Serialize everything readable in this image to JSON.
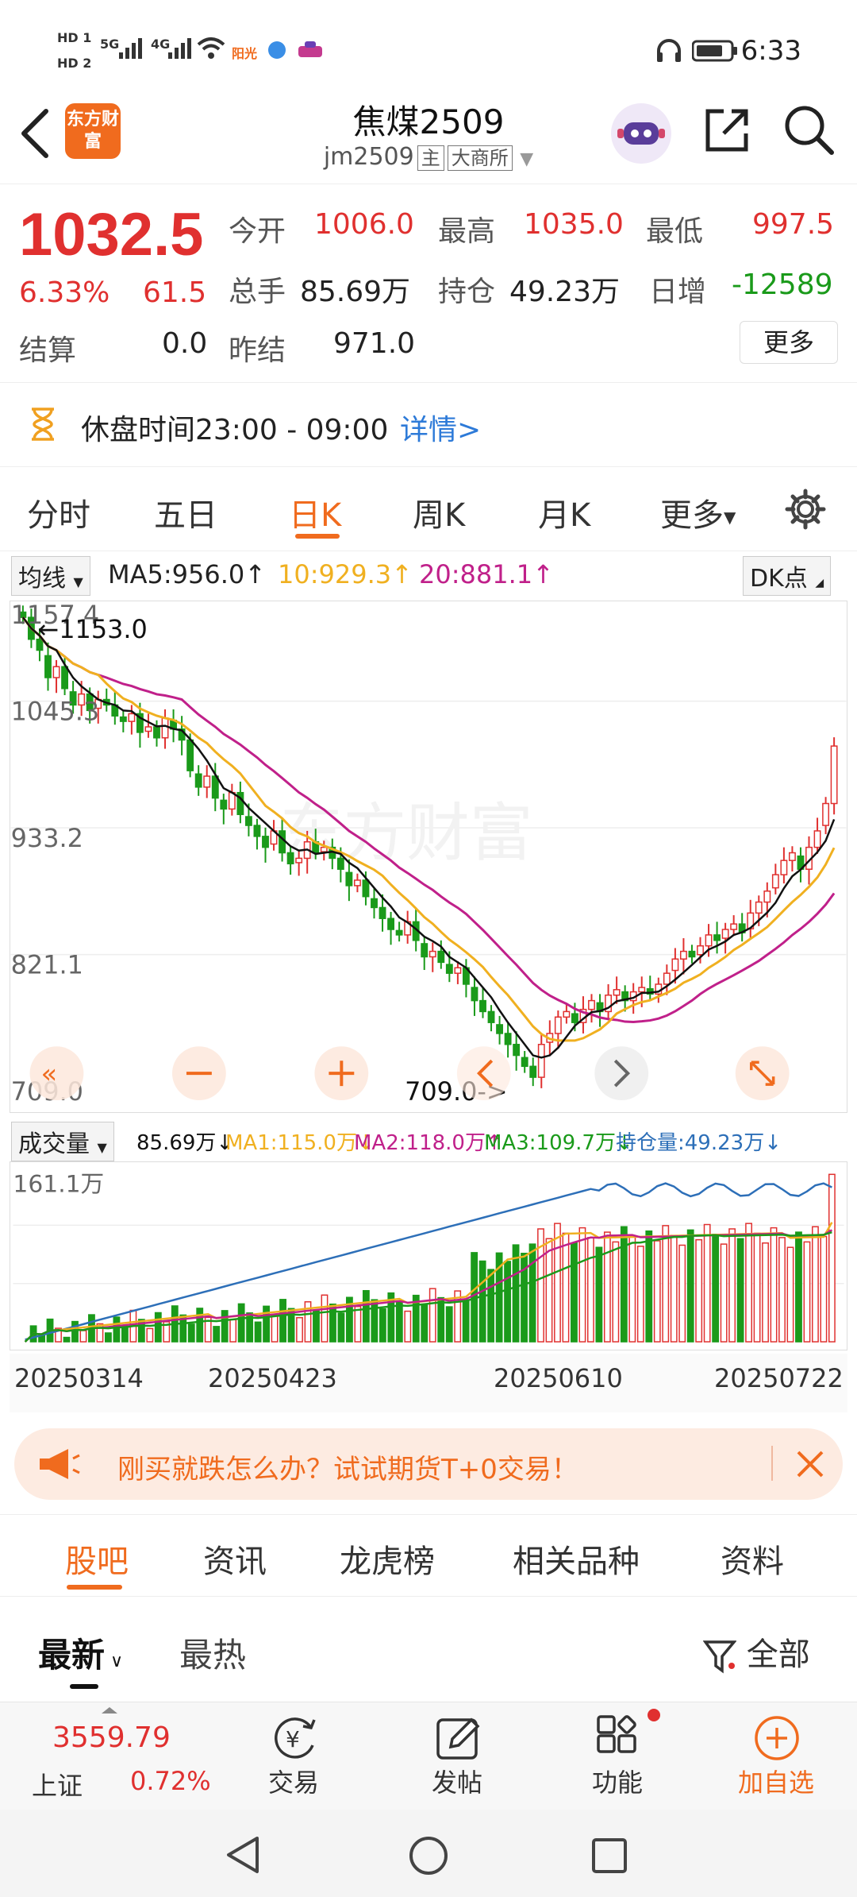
{
  "status": {
    "time": "6:33",
    "sim1": "HD 1",
    "sim2": "HD 2",
    "net1": "5G",
    "net2": "4G",
    "app_badge": "阳光"
  },
  "header": {
    "logo": "东方财富",
    "title": "焦煤2509",
    "code": "jm2509",
    "tag_main": "主",
    "tag_exchange": "大商所"
  },
  "quote": {
    "price": "1032.5",
    "change_pct": "6.33%",
    "change_abs": "61.5",
    "open_label": "今开",
    "open": "1006.0",
    "high_label": "最高",
    "high": "1035.0",
    "low_label": "最低",
    "low": "997.5",
    "volume_label": "总手",
    "volume": "85.69万",
    "oi_label": "持仓",
    "oi": "49.23万",
    "daily_inc_label": "日增",
    "daily_inc": "-12589",
    "settle_label": "结算",
    "settle": "0.0",
    "prev_settle_label": "昨结",
    "prev_settle": "971.0",
    "more": "更多"
  },
  "break_info": {
    "text": "休盘时间23:00 - 09:00",
    "link": "详情>"
  },
  "period_tabs": [
    {
      "label": "分时"
    },
    {
      "label": "五日"
    },
    {
      "label": "日K"
    },
    {
      "label": "周K"
    },
    {
      "label": "月K"
    },
    {
      "label": "更多"
    }
  ],
  "ma_row": {
    "selector": "均线",
    "ma5": "MA5:956.0",
    "ma10": "10:929.3",
    "ma20": "20:881.1",
    "dk": "DK点"
  },
  "kline": {
    "y_labels": [
      "1157.4",
      "1045.3",
      "933.2",
      "821.1",
      "709.0"
    ],
    "max_label": "1153.0",
    "min_label": "709.0->"
  },
  "vol_row": {
    "selector": "成交量",
    "vol": "85.69万",
    "ma1": "MA1:115.0万",
    "ma2": "MA2:118.0万",
    "ma3": "MA3:109.7万",
    "oi": "持仓量:49.23万"
  },
  "volume_chart": {
    "y_label": "161.1万"
  },
  "dates": [
    "20250314",
    "20250423",
    "20250610",
    "20250722"
  ],
  "banner": {
    "text": "刚买就跌怎么办？试试期货T+0交易！"
  },
  "bottom_tabs": [
    {
      "label": "股吧"
    },
    {
      "label": "资讯"
    },
    {
      "label": "龙虎榜"
    },
    {
      "label": "相关品种"
    },
    {
      "label": "资料"
    }
  ],
  "sort": {
    "latest": "最新",
    "hot": "最热",
    "filter": "全部"
  },
  "index": {
    "value": "3559.79",
    "name": "上证",
    "pct": "0.72%"
  },
  "nav": [
    {
      "label": "交易",
      "icon": "yuan-icon"
    },
    {
      "label": "发帖",
      "icon": "edit-icon"
    },
    {
      "label": "功能",
      "icon": "grid-icon"
    },
    {
      "label": "加自选",
      "icon": "plus-circle-icon"
    }
  ],
  "chart_data": {
    "type": "candlestick",
    "x_ticks": [
      "20250314",
      "20250423",
      "20250610",
      "20250722"
    ],
    "y_ticks": [
      1157.4,
      1045.3,
      933.2,
      821.1,
      709.0
    ],
    "ylim": [
      709.0,
      1157.4
    ],
    "close": [
      1150,
      1130,
      1120,
      1095,
      1105,
      1085,
      1070,
      1080,
      1065,
      1075,
      1070,
      1060,
      1055,
      1062,
      1045,
      1050,
      1040,
      1058,
      1048,
      1038,
      1010,
      995,
      1005,
      985,
      975,
      990,
      970,
      960,
      950,
      940,
      955,
      935,
      925,
      930,
      945,
      935,
      940,
      930,
      920,
      905,
      910,
      895,
      885,
      875,
      865,
      860,
      872,
      855,
      840,
      845,
      835,
      825,
      830,
      815,
      800,
      790,
      780,
      770,
      760,
      750,
      740,
      730,
      760,
      770,
      785,
      790,
      780,
      792,
      800,
      790,
      805,
      810,
      800,
      808,
      812,
      806,
      815,
      825,
      838,
      845,
      840,
      850,
      860,
      855,
      865,
      870,
      862,
      880,
      890,
      900,
      915,
      928,
      935,
      920,
      940,
      955,
      980,
      1032.5
    ],
    "ma5_last": 956.0,
    "ma10_last": 929.3,
    "ma20_last": 881.1,
    "volume_ylim": [
      0,
      161.1
    ],
    "volume_last": 85.69,
    "vol_ma1_last": 115.0,
    "vol_ma2_last": 118.0,
    "vol_ma3_last": 109.7,
    "oi_last": 49.23
  }
}
